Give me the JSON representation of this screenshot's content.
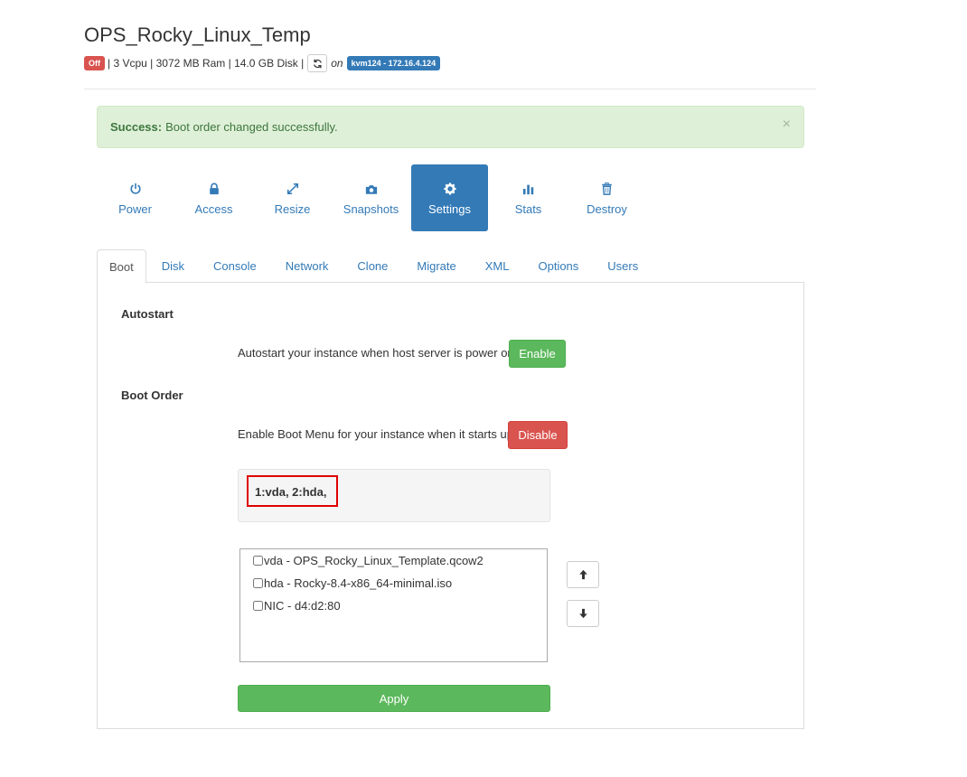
{
  "instance": {
    "name": "OPS_Rocky_Linux_Temp",
    "status": "Off",
    "specs": "| 3 Vcpu | 3072 MB Ram | 14.0 GB Disk |",
    "on_label": "on",
    "host": "kvm124 - 172.16.4.124"
  },
  "alert": {
    "title": "Success:",
    "message": "Boot order changed successfully.",
    "close": "×"
  },
  "actions": [
    {
      "label": "Power",
      "icon": "power-icon"
    },
    {
      "label": "Access",
      "icon": "lock-icon"
    },
    {
      "label": "Resize",
      "icon": "resize-icon"
    },
    {
      "label": "Snapshots",
      "icon": "camera-icon"
    },
    {
      "label": "Settings",
      "icon": "gear-icon",
      "active": true
    },
    {
      "label": "Stats",
      "icon": "stats-icon"
    },
    {
      "label": "Destroy",
      "icon": "trash-icon"
    }
  ],
  "tabs": [
    "Boot",
    "Disk",
    "Console",
    "Network",
    "Clone",
    "Migrate",
    "XML",
    "Options",
    "Users"
  ],
  "autostart": {
    "heading": "Autostart",
    "description": "Autostart your instance when host server is power on",
    "button": "Enable"
  },
  "boot_order": {
    "heading": "Boot Order",
    "description": "Enable Boot Menu for your instance when it starts up",
    "button": "Disable",
    "current_order": "1:vda, 2:hda,",
    "devices": [
      "vda - OPS_Rocky_Linux_Template.qcow2",
      "hda - Rocky-8.4-x86_64-minimal.iso",
      "NIC - d4:d2:80"
    ],
    "apply": "Apply"
  },
  "colors": {
    "primary": "#337ab7",
    "success": "#5cb85c",
    "danger": "#d9534f",
    "alert_bg": "#dff0d8",
    "highlight": "#e00000"
  }
}
